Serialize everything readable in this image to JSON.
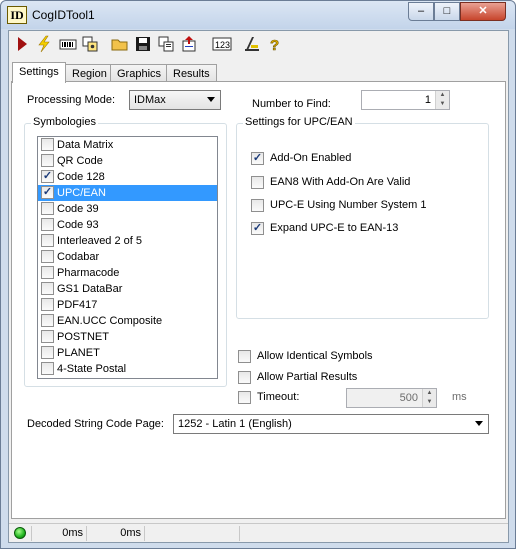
{
  "window": {
    "title": "CogIDTool1",
    "app_icon_text": "ID",
    "minimize": "‒",
    "maximize": "□",
    "close": "✕"
  },
  "toolbar": {
    "icons": [
      "run-icon",
      "lightning-icon",
      "barcode-icon",
      "settings-icon",
      "open-folder-icon",
      "save-icon",
      "copy-icon",
      "import-icon",
      "numeric-icon",
      "train-icon",
      "help-icon"
    ]
  },
  "tabs": [
    {
      "label": "Settings",
      "active": true
    },
    {
      "label": "Region"
    },
    {
      "label": "Graphics"
    },
    {
      "label": "Results"
    }
  ],
  "settings": {
    "processing_mode_label": "Processing Mode:",
    "processing_mode_value": "IDMax",
    "number_to_find_label": "Number to Find:",
    "number_to_find_value": "1",
    "symbologies_title": "Symbologies",
    "symbologies": [
      {
        "label": "Data Matrix",
        "checked": false
      },
      {
        "label": "QR Code",
        "checked": false
      },
      {
        "label": "Code 128",
        "checked": true
      },
      {
        "label": "UPC/EAN",
        "checked": true,
        "selected": true
      },
      {
        "label": "Code 39",
        "checked": false
      },
      {
        "label": "Code 93",
        "checked": false
      },
      {
        "label": "Interleaved 2 of 5",
        "checked": false
      },
      {
        "label": "Codabar",
        "checked": false
      },
      {
        "label": "Pharmacode",
        "checked": false
      },
      {
        "label": "GS1 DataBar",
        "checked": false
      },
      {
        "label": "PDF417",
        "checked": false
      },
      {
        "label": "EAN.UCC Composite",
        "checked": false
      },
      {
        "label": "POSTNET",
        "checked": false
      },
      {
        "label": "PLANET",
        "checked": false
      },
      {
        "label": "4-State Postal",
        "checked": false
      }
    ],
    "upc_title": "Settings for UPC/EAN",
    "upc_options": [
      {
        "label": "Add-On Enabled",
        "checked": true
      },
      {
        "label": "EAN8 With Add-On Are Valid",
        "checked": false
      },
      {
        "label": "UPC-E Using Number System 1",
        "checked": false
      },
      {
        "label": "Expand UPC-E to EAN-13",
        "checked": true
      }
    ],
    "allow_identical_label": "Allow Identical Symbols",
    "allow_partial_label": "Allow Partial Results",
    "timeout_label": "Timeout:",
    "timeout_value": "500",
    "timeout_unit": "ms",
    "code_page_label": "Decoded String Code Page:",
    "code_page_value": "1252 - Latin 1 (English)"
  },
  "status": {
    "time1": "0ms",
    "time2": "0ms"
  }
}
